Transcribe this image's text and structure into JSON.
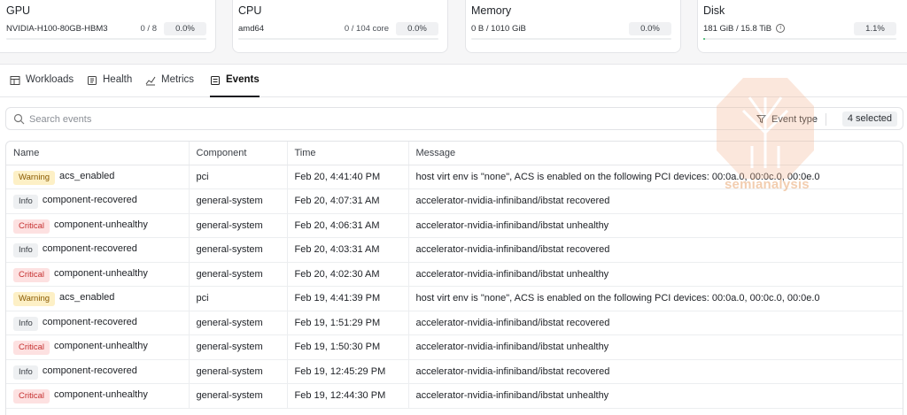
{
  "resources": {
    "gpu": {
      "title": "GPU",
      "name": "NVIDIA-H100-80GB-HBM3",
      "ratio": "0 / 8",
      "pct": "0.0%",
      "fill": 0.0
    },
    "cpu": {
      "title": "CPU",
      "name": "amd64",
      "ratio": "0 / 104 core",
      "pct": "0.0%",
      "fill": 0.0
    },
    "memory": {
      "title": "Memory",
      "name": "0 B / 1010 GiB",
      "pct": "0.0%",
      "fill": 0.0
    },
    "disk": {
      "title": "Disk",
      "name": "181 GiB / 15.8 TiB",
      "pct": "1.1%",
      "fill": 0.011
    }
  },
  "tabs": [
    {
      "label": "Workloads",
      "icon": "table-icon"
    },
    {
      "label": "Health",
      "icon": "health-icon"
    },
    {
      "label": "Metrics",
      "icon": "chart-icon"
    },
    {
      "label": "Events",
      "icon": "list-icon",
      "active": true
    }
  ],
  "search": {
    "placeholder": "Search events"
  },
  "filter": {
    "label": "Event type",
    "selected": "4 selected"
  },
  "watermark": {
    "text": "semianalysis"
  },
  "table": {
    "headers": [
      "Name",
      "Component",
      "Time",
      "Message"
    ],
    "rows": [
      {
        "level": "Warning",
        "name": "acs_enabled",
        "component": "pci",
        "time": "Feb 20, 4:41:40 PM",
        "message": "host virt env is \"none\", ACS is enabled on the following PCI devices: 00:0a.0, 00:0c.0, 00:0e.0"
      },
      {
        "level": "Info",
        "name": "component-recovered",
        "component": "general-system",
        "time": "Feb 20, 4:07:31 AM",
        "message": "accelerator-nvidia-infiniband/ibstat recovered"
      },
      {
        "level": "Critical",
        "name": "component-unhealthy",
        "component": "general-system",
        "time": "Feb 20, 4:06:31 AM",
        "message": "accelerator-nvidia-infiniband/ibstat unhealthy"
      },
      {
        "level": "Info",
        "name": "component-recovered",
        "component": "general-system",
        "time": "Feb 20, 4:03:31 AM",
        "message": "accelerator-nvidia-infiniband/ibstat recovered"
      },
      {
        "level": "Critical",
        "name": "component-unhealthy",
        "component": "general-system",
        "time": "Feb 20, 4:02:30 AM",
        "message": "accelerator-nvidia-infiniband/ibstat unhealthy"
      },
      {
        "level": "Warning",
        "name": "acs_enabled",
        "component": "pci",
        "time": "Feb 19, 4:41:39 PM",
        "message": "host virt env is \"none\", ACS is enabled on the following PCI devices: 00:0a.0, 00:0c.0, 00:0e.0"
      },
      {
        "level": "Info",
        "name": "component-recovered",
        "component": "general-system",
        "time": "Feb 19, 1:51:29 PM",
        "message": "accelerator-nvidia-infiniband/ibstat recovered"
      },
      {
        "level": "Critical",
        "name": "component-unhealthy",
        "component": "general-system",
        "time": "Feb 19, 1:50:30 PM",
        "message": "accelerator-nvidia-infiniband/ibstat unhealthy"
      },
      {
        "level": "Info",
        "name": "component-recovered",
        "component": "general-system",
        "time": "Feb 19, 12:45:29 PM",
        "message": "accelerator-nvidia-infiniband/ibstat recovered"
      },
      {
        "level": "Critical",
        "name": "component-unhealthy",
        "component": "general-system",
        "time": "Feb 19, 12:44:30 PM",
        "message": "accelerator-nvidia-infiniband/ibstat unhealthy"
      }
    ]
  }
}
